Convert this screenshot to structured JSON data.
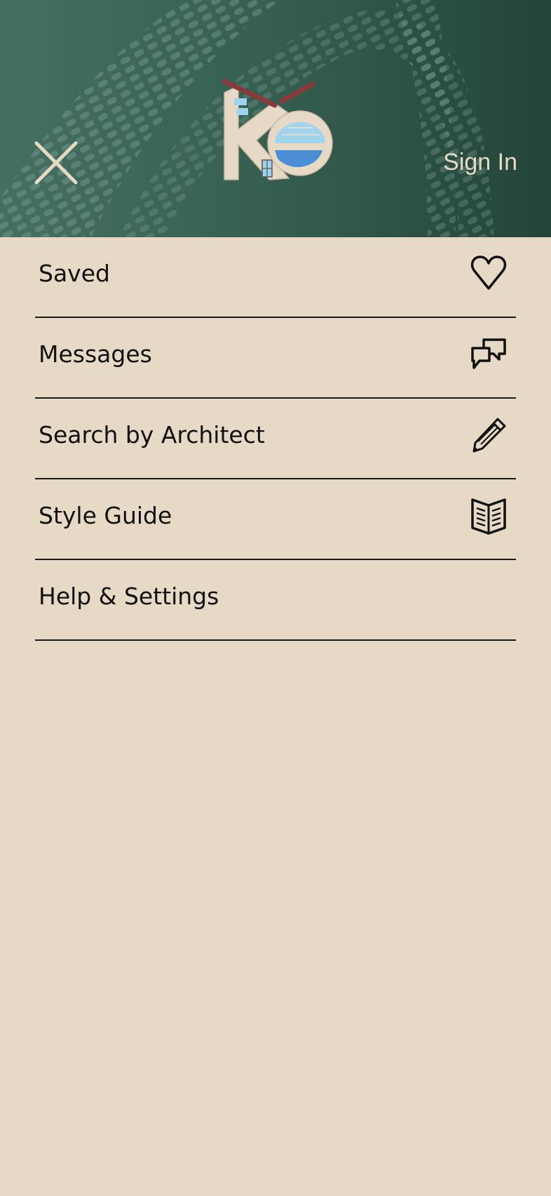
{
  "header": {
    "sign_in_label": "Sign In",
    "close_icon": "close-icon",
    "logo_icon": "ke-house-logo"
  },
  "colors": {
    "header_bg": "#2e5446",
    "page_bg": "#e6d9c6",
    "header_text": "#e6d9c6",
    "text": "#111111",
    "logo_roof": "#8a3a3a",
    "logo_window": "#9fd4ef",
    "logo_accent": "#4a8fd6"
  },
  "menu": {
    "items": [
      {
        "label": "Saved",
        "icon": "heart-icon"
      },
      {
        "label": "Messages",
        "icon": "chat-bubbles-icon"
      },
      {
        "label": "Search by Architect",
        "icon": "pencil-icon"
      },
      {
        "label": "Style Guide",
        "icon": "book-icon"
      },
      {
        "label": "Help & Settings",
        "icon": ""
      }
    ]
  }
}
